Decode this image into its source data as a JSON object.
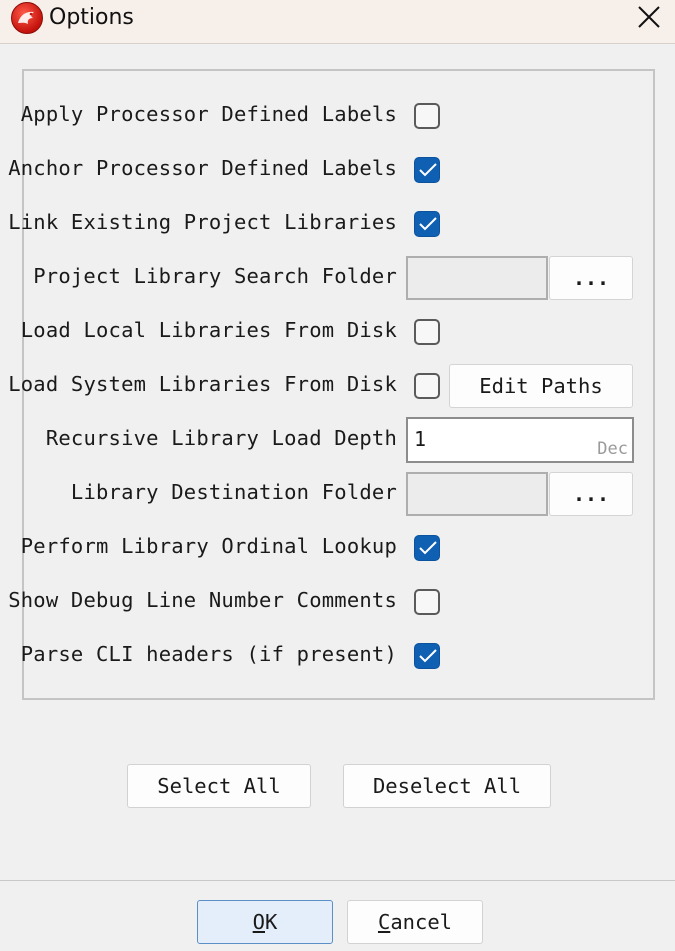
{
  "window": {
    "title": "Options",
    "icon": "app-dragon-icon",
    "close_icon": "close-icon"
  },
  "options": [
    {
      "label": "Apply Processor Defined Labels",
      "checked": false
    },
    {
      "label": "Anchor Processor Defined Labels",
      "checked": true
    },
    {
      "label": "Link Existing Project Libraries",
      "checked": true
    },
    {
      "label": "Project Library Search Folder",
      "control": "folder-field",
      "value": "",
      "browse_label": "..."
    },
    {
      "label": "Load Local Libraries From Disk",
      "checked": false
    },
    {
      "label": "Load System Libraries From Disk",
      "checked": false,
      "button_label": "Edit Paths"
    },
    {
      "label": "Recursive Library Load Depth",
      "control": "number-field",
      "value": "1",
      "suffix": "Dec"
    },
    {
      "label": "Library Destination Folder",
      "control": "folder-field",
      "value": "",
      "browse_label": "..."
    },
    {
      "label": "Perform Library Ordinal Lookup",
      "checked": true
    },
    {
      "label": "Show Debug Line Number Comments",
      "checked": false
    },
    {
      "label": "Parse CLI headers (if present)",
      "checked": true
    }
  ],
  "selection_buttons": {
    "select_all": "Select All",
    "deselect_all": "Deselect All"
  },
  "footer": {
    "ok_mnemonic": "O",
    "ok_rest": "K",
    "cancel_mnemonic": "C",
    "cancel_rest": "ancel"
  },
  "colors": {
    "checked_fill": "#0f5fb3",
    "title_bar": "#f7efea",
    "ok_button": "#e3eefa"
  }
}
